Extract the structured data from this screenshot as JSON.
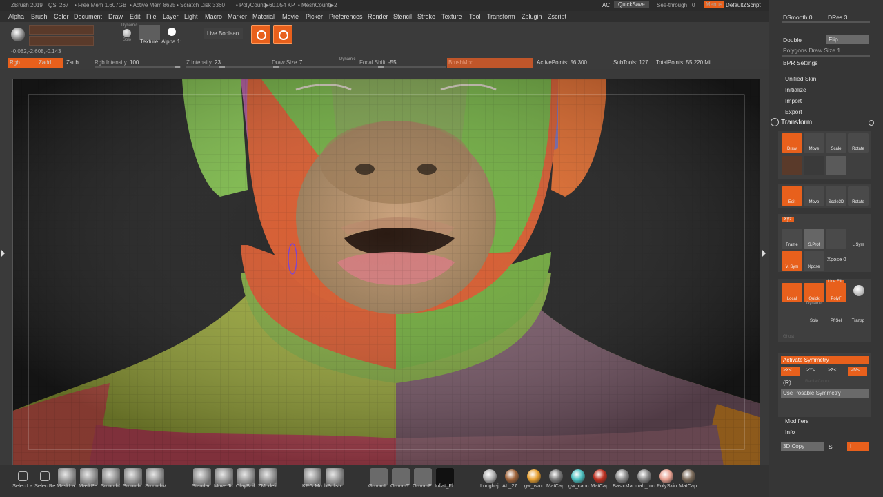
{
  "title_bar": {
    "app": "ZBrush 2019",
    "doc": "QS_267",
    "free_mem": "• Free Mem 1.607GB",
    "active_mem": "• Active Mem 8625",
    "scratch": "• Scratch Disk 3360",
    "polycount": "• PolyCount▶60.054 KP",
    "meshcount": "• MeshCount▶2",
    "ac": "AC",
    "quicksave": "QuickSave",
    "see_through": "See-through",
    "see_through_val": "0",
    "menus": "Menus",
    "script": "DefaultZScript"
  },
  "menus": [
    "Alpha",
    "Brush",
    "Color",
    "Document",
    "Draw",
    "Edit",
    "File",
    "Layer",
    "Light",
    "Macro",
    "Marker",
    "Material",
    "Movie",
    "Picker",
    "Preferences",
    "Render",
    "Stencil",
    "Stroke",
    "Texture",
    "Tool",
    "Transform",
    "Zplugin",
    "Zscript"
  ],
  "toolbar": {
    "coords": "-0.082,-2.608,-0.143",
    "texture_label": "Texture",
    "alpha_label": "Alpha 1:",
    "dynamic_label": "Dynamic",
    "solo_label": "Solo",
    "live_boolean": "Live Boolean",
    "rgb": "Rgb",
    "zadd": "Zadd",
    "zsub": "Zsub",
    "rgb_intensity_label": "Rgb Intensity",
    "rgb_intensity": "100",
    "z_intensity_label": "Z Intensity",
    "z_intensity": "23",
    "draw_size_label": "Draw Size",
    "draw_size": "7",
    "dynamic_small": "Dynamic",
    "focal_shift_label": "Focal Shift",
    "focal_shift": "-55",
    "brushmod": "BrushMod",
    "active_points": "ActivePoints: 56,300",
    "subtools": "SubTools: 127",
    "total_points": "TotalPoints: 55.220 Mil"
  },
  "right_panel": {
    "dsmooth": "DSmooth 0",
    "dres": "DRes 3",
    "double": "Double",
    "flip": "Flip",
    "polygons_draw_size": "Polygons Draw Size 1",
    "bpr_settings": "BPR Settings",
    "unified_skin": "Unified Skin",
    "initialize": "Initialize",
    "import": "Import",
    "export": "Export",
    "transform_header": "Transform",
    "row1": [
      "Draw",
      "Move",
      "Scale",
      "Rotate"
    ],
    "row3": [
      "Edit",
      "Move",
      "Scale3D",
      "Rotate"
    ],
    "xyz": "Xyz",
    "row4": [
      "Frame",
      "S.Prof",
      "",
      "L.Sym"
    ],
    "row5": [
      "V. Sym",
      "Xpose"
    ],
    "xpose_val": "Xpose 0",
    "line_fill": "Line Fill",
    "row6": [
      "Local",
      "Quick",
      "PolyF",
      ""
    ],
    "dynamic": "Dynamic",
    "row7": [
      "",
      "Solo",
      "Pf Sel",
      "Transp"
    ],
    "ghost": "Ghost",
    "activate_symmetry": "Activate Symmetry",
    "sym_x": ">X<",
    "sym_y": ">Y<",
    "sym_z": ">Z<",
    "sym_m": ">M<",
    "r": "(R)",
    "radial_count": "RadialCount",
    "use_posable": "Use Posable Symmetry",
    "modifiers": "Modifiers",
    "info": "Info",
    "copy3d": "3D Copy",
    "copy_s": "S",
    "copy_i": "I"
  },
  "bottom_tools": [
    "SelectLa",
    "SelectRe",
    "MaskLa",
    "MaskPe",
    "SmoothI",
    "Smooth",
    "SmoothV",
    "Standar",
    "Move Tc",
    "ClayBuil",
    "ZModeli",
    "KRG Mu",
    "hPolish",
    "GroomI",
    "GroomT",
    "GroomE",
    "Inflat_Fl"
  ],
  "bottom_mats": [
    "Longhi-j",
    "AL_27",
    "gw_wax",
    "MatCap",
    "gw_canc",
    "MatCap",
    "BasicMa",
    "mah_mc",
    "PolySkin",
    "MatCap"
  ],
  "colors": {
    "accent": "#e8601c",
    "panel": "#363636",
    "viewport_bg": "#1e1e1e"
  }
}
